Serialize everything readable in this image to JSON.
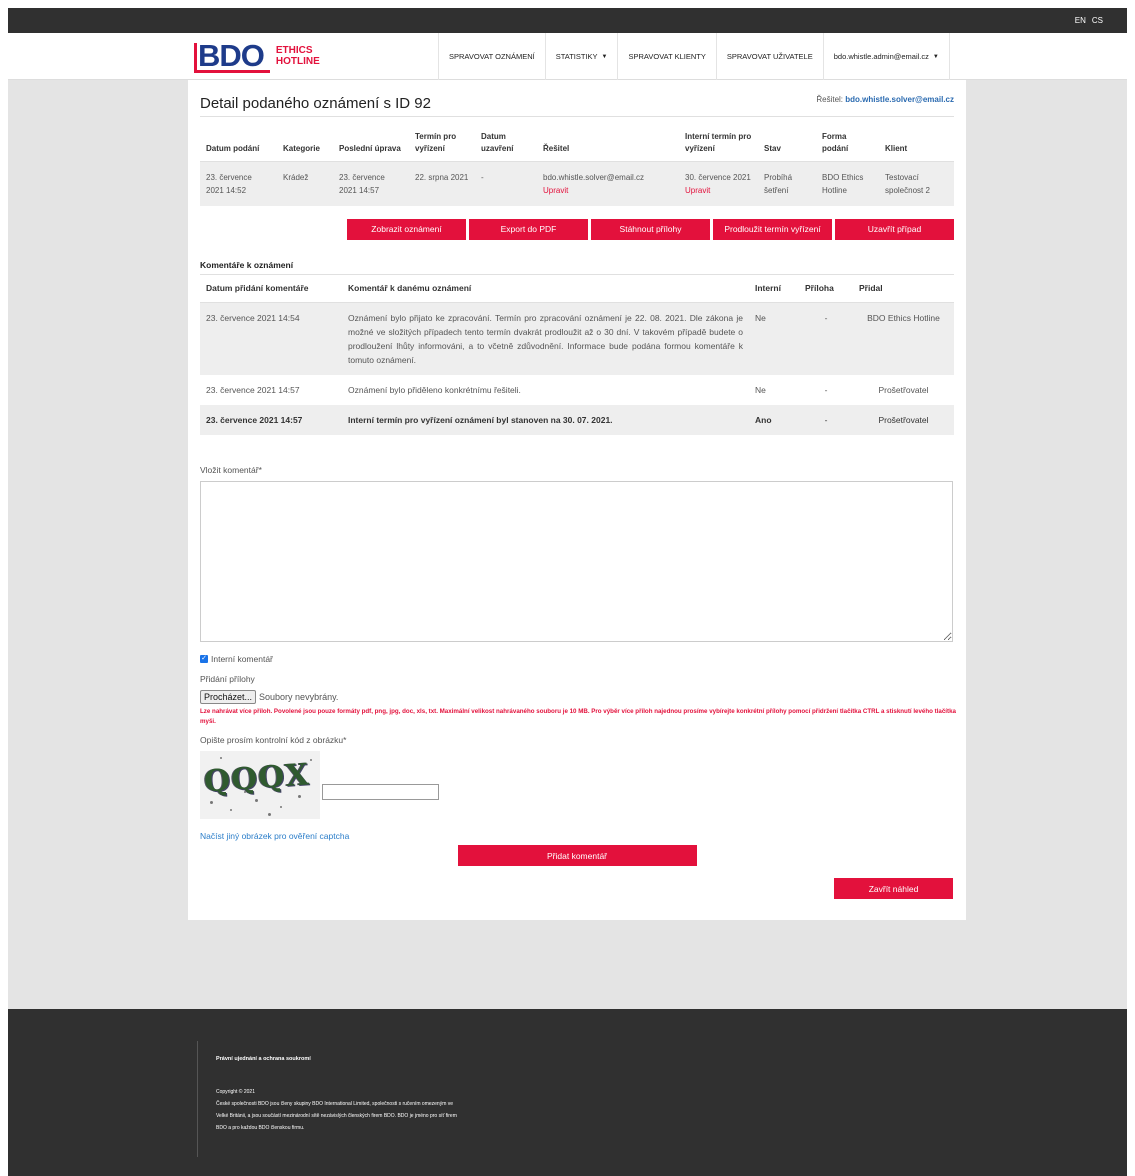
{
  "topbar": {
    "lang_en": "EN",
    "lang_cs": "CS"
  },
  "logo": {
    "brand": "BDO",
    "line1": "ETHICS",
    "line2": "HOTLINE"
  },
  "nav": {
    "manage_reports": "SPRAVOVAT OZNÁMENÍ",
    "statistics": "STATISTIKY",
    "manage_clients": "SPRAVOVAT KLIENTY",
    "manage_users": "SPRAVOVAT UŽIVATELE",
    "user": "bdo.whistle.admin@email.cz"
  },
  "detail": {
    "title": "Detail podaného oznámení s ID 92",
    "solver_label": "Řešitel:",
    "solver_email": "bdo.whistle.solver@email.cz",
    "columns": [
      "Datum podání",
      "Kategorie",
      "Poslední úprava",
      "Termín pro vyřízení",
      "Datum uzavření",
      "Řešitel",
      "Interní termín pro vyřízení",
      "Stav",
      "Forma podání",
      "Klient"
    ],
    "row": {
      "submitted": "23. července 2021 14:52",
      "category": "Krádež",
      "last_edit": "23. července 2021 14:57",
      "deadline": "22. srpna 2021",
      "closed": "-",
      "solver": "bdo.whistle.solver@email.cz",
      "solver_edit": "Upravit",
      "internal_deadline": "30. července 2021",
      "internal_edit": "Upravit",
      "status": "Probíhá šetření",
      "form": "BDO Ethics Hotline",
      "client": "Testovací společnost 2"
    }
  },
  "actions": {
    "show": "Zobrazit oznámení",
    "export": "Export do PDF",
    "download": "Stáhnout přílohy",
    "extend": "Prodloužit termín vyřízení",
    "close": "Uzavřít případ"
  },
  "comments": {
    "title": "Komentáře k oznámení",
    "columns": [
      "Datum přidání komentáře",
      "Komentář k danému oznámení",
      "Interní",
      "Příloha",
      "Přidal"
    ],
    "rows": [
      {
        "date": "23. července 2021 14:54",
        "text": "Oznámení bylo přijato ke zpracování. Termín pro zpracování oznámení je 22. 08. 2021. Dle zákona je možné ve složitých případech tento termín dvakrát prodloužit až o 30 dní. V takovém případě budete o prodloužení lhůty informováni, a to včetně zdůvodnění. Informace bude podána formou komentáře k tomuto oznámení.",
        "internal": "Ne",
        "attachment": "-",
        "author": "BDO Ethics Hotline"
      },
      {
        "date": "23. července 2021 14:57",
        "text": "Oznámení bylo přiděleno konkrétnímu řešiteli.",
        "internal": "Ne",
        "attachment": "-",
        "author": "Prošetřovatel"
      },
      {
        "date": "23. července 2021 14:57",
        "text": "Interní termín pro vyřízení oznámení byl stanoven na 30. 07. 2021.",
        "internal": "Ano",
        "attachment": "-",
        "author": "Prošetřovatel"
      }
    ]
  },
  "form": {
    "comment_label": "Vložit komentář*",
    "internal_label": "Interní komentář",
    "attach_label": "Přidání přílohy",
    "browse": "Procházet...",
    "no_files": "Soubory nevybrány.",
    "warning": "Lze nahrávat více příloh. Povolené jsou pouze formáty pdf, png, jpg, doc, xls, txt. Maximální velikost nahrávaného souboru je 10 MB. Pro výběr více příloh najednou prosíme vybírejte konkrétní přílohy pomocí přidržení tlačítka CTRL a stisknutí levého tlačítka myši.",
    "captcha_label": "Opište prosím kontrolní kód z obrázku*",
    "captcha_text": "QQQX",
    "reload_captcha": "Načíst jiný obrázek pro ověření captcha",
    "add_comment": "Přidat komentář",
    "close_preview": "Zavřít náhled"
  },
  "footer": {
    "legal": "Právní ujednání a ochrana soukromí",
    "copyright": "Copyright © 2021",
    "line1": "České společnosti BDO jsou členy skupiny BDO International Limited, společnosti s ručením omezeným ve",
    "line2": "Velké Británii, a jsou součástí mezinárodní sítě nezávislých členských firem BDO. BDO je jméno pro síť firem",
    "line3": "BDO a pro každou BDO členskou firmu."
  }
}
